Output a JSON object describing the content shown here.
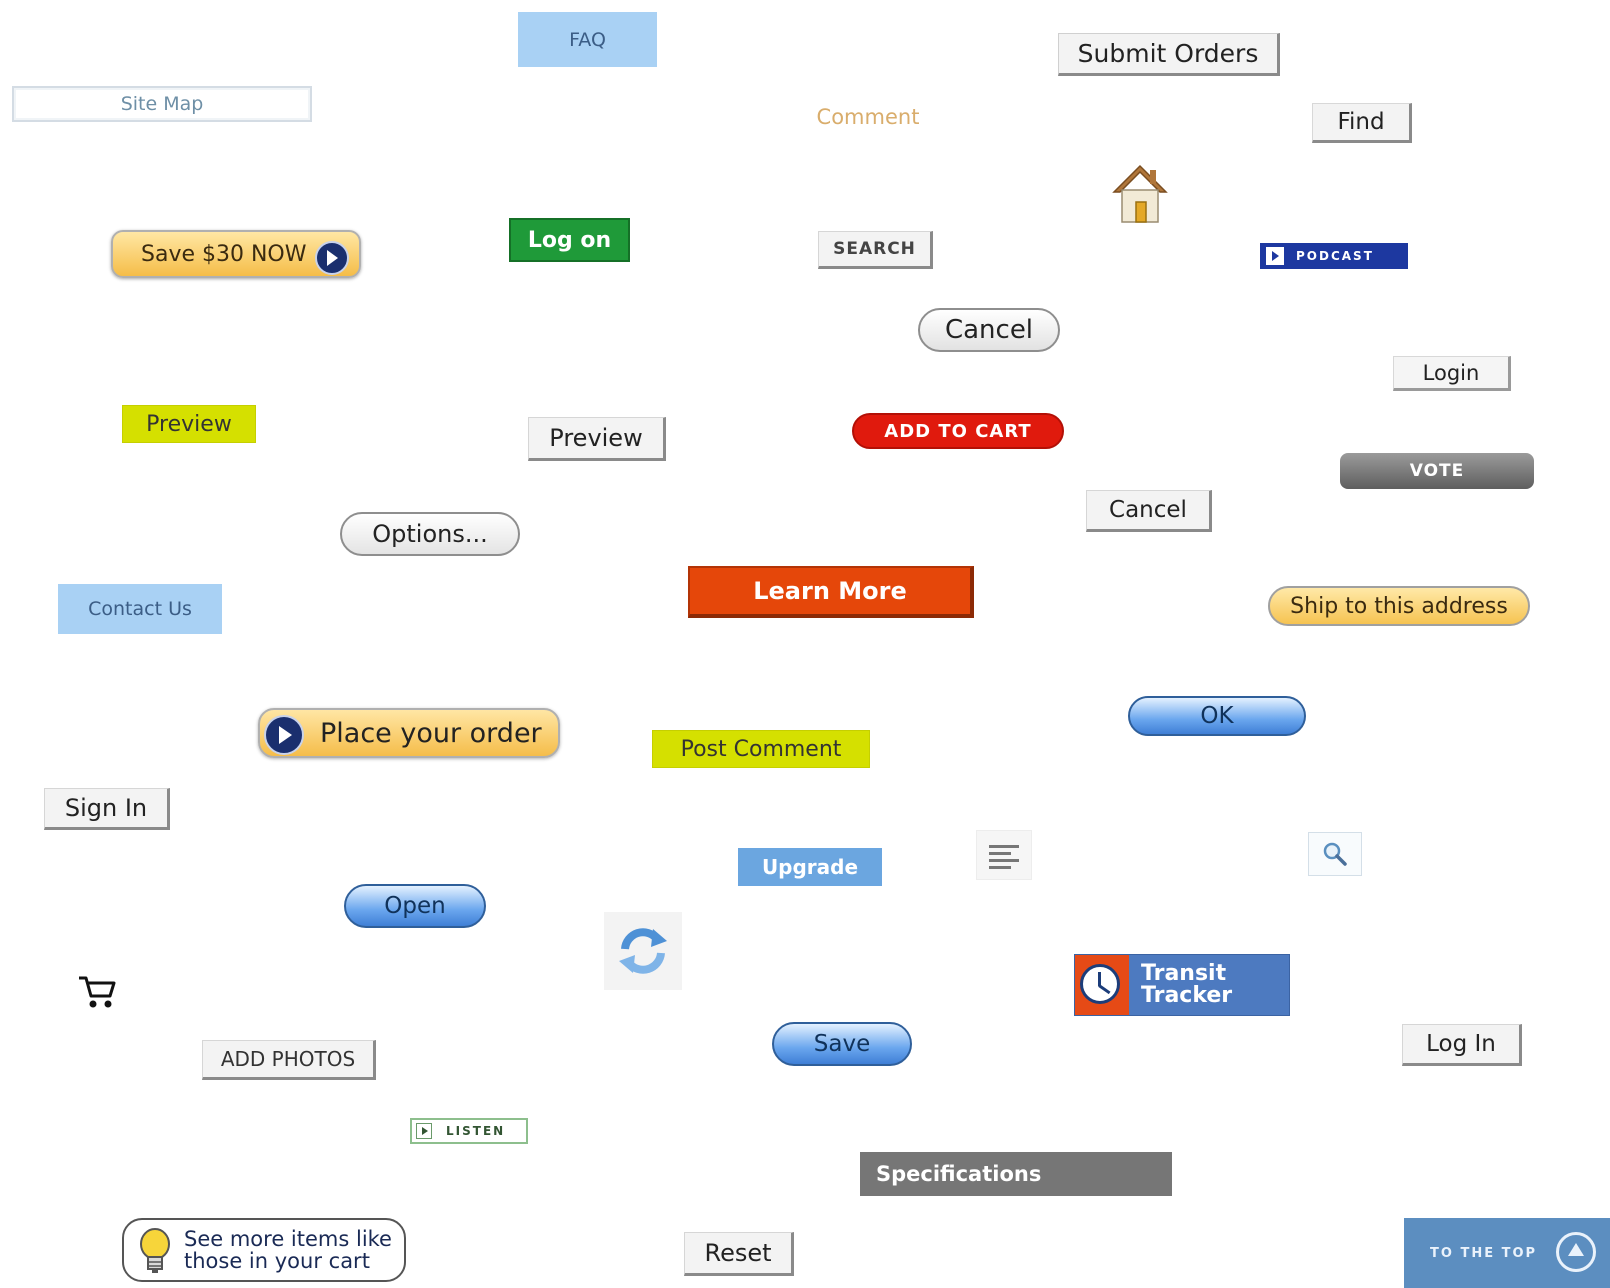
{
  "buttons": {
    "faq": "FAQ",
    "submit_orders": "Submit Orders",
    "site_map": "Site Map",
    "comment": "Comment",
    "find": "Find",
    "save_30_now": "Save $30 NOW",
    "log_on": "Log on",
    "search": "SEARCH",
    "podcast": "PODCAST",
    "cancel": "Cancel",
    "login": "Login",
    "preview": "Preview",
    "add_to_cart": "ADD TO CART",
    "vote": "VOTE",
    "options": "Options...",
    "learn_more": "Learn More",
    "contact_us": "Contact Us",
    "ship_to_this_address": "Ship to this address",
    "ok": "OK",
    "place_your_order": "Place your order",
    "post_comment": "Post Comment",
    "sign_in": "Sign In",
    "upgrade": "Upgrade",
    "open": "Open",
    "transit_line1": "Transit",
    "transit_line2": "Tracker",
    "save": "Save",
    "log_in": "Log In",
    "add_photos": "ADD PHOTOS",
    "listen": "LISTEN",
    "specifications": "Specifications",
    "see_more_line1": "See more items like",
    "see_more_line2": "those in your cart",
    "reset": "Reset",
    "to_the_top": "TO THE TOP"
  },
  "icons": {
    "home": "home-icon",
    "align": "text-align-left-icon",
    "zoom": "magnifier-icon",
    "refresh": "refresh-icon",
    "cart": "shopping-cart-icon",
    "clock": "clock-icon",
    "bulb": "lightbulb-icon",
    "play": "play-icon",
    "up": "arrow-up-circle-icon"
  },
  "colors": {
    "light_blue": "#a9d1f4",
    "yellow_green": "#d5e000",
    "orange": "#e5470a",
    "red": "#e01a0d",
    "green": "#1f9a39",
    "gold": "#f5bd48",
    "blue_pill": "#6aa6ee",
    "transit_blue": "#4d7ac0",
    "top_blue": "#5c8ec0"
  }
}
